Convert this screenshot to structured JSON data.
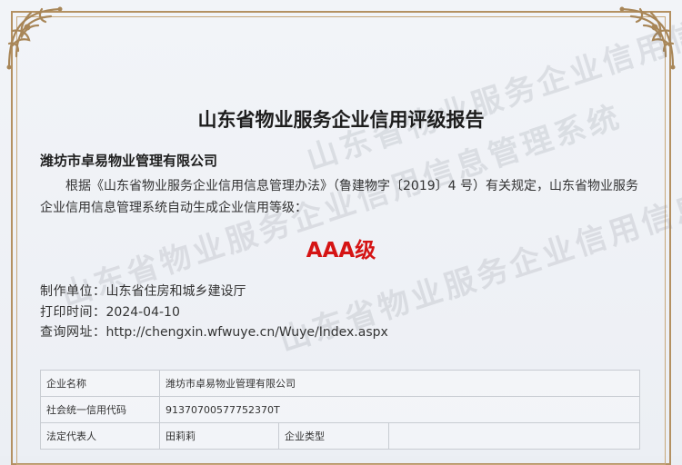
{
  "watermark_text": "山东省物业服务企业信用信息管理系统",
  "title": "山东省物业服务企业信用评级报告",
  "company": "潍坊市卓易物业管理有限公司",
  "paragraph": "根据《山东省物业服务企业信用信息管理办法》（鲁建物字〔2019〕4 号）有关规定，山东省物业服务企业信用信息管理系统自动生成企业信用等级：",
  "grade": "AAA级",
  "info": {
    "maker_label": "制作单位：",
    "maker": "山东省住房和城乡建设厅",
    "print_label": "打印时间：",
    "print_date": "2024-04-10",
    "url_label": "查询网址：",
    "url": "http://chengxin.wfwuye.cn/Wuye/Index.aspx"
  },
  "table": {
    "name_label": "企业名称",
    "name_value": "潍坊市卓易物业管理有限公司",
    "code_label": "社会统一信用代码",
    "code_value": "91370700577752370T",
    "rep_label": "法定代表人",
    "rep_value": "田莉莉",
    "type_label": "企业类型",
    "type_value": ""
  },
  "colors": {
    "frame": "#b49162",
    "grade": "#d51414"
  }
}
